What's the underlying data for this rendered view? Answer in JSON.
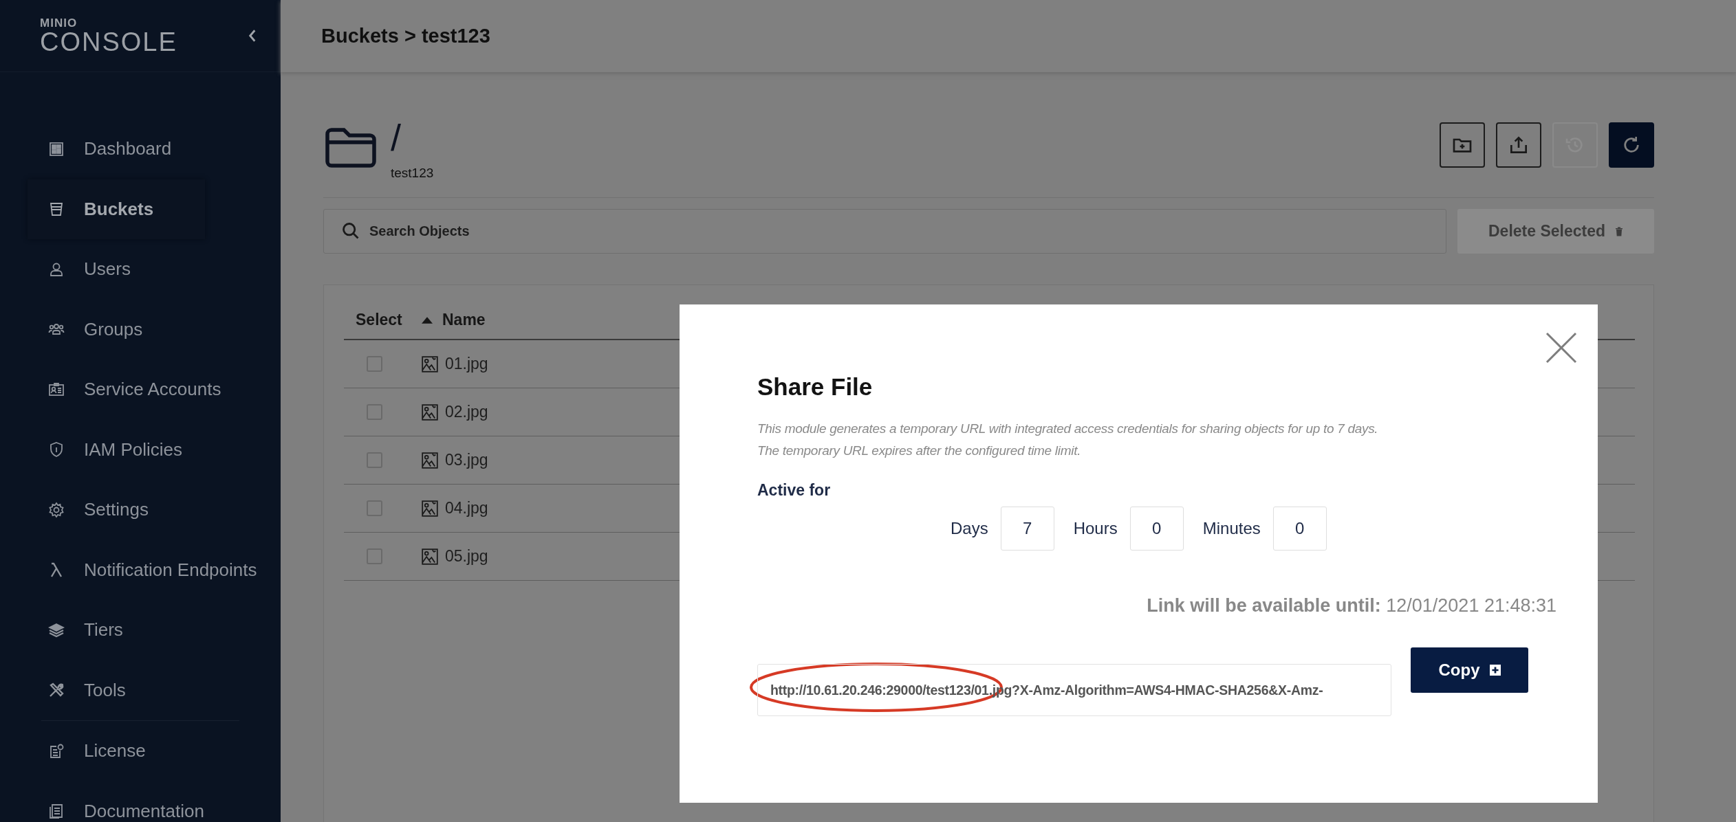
{
  "sidebar": {
    "logo_small": "MINIO",
    "logo": "CONSOLE",
    "items": [
      {
        "label": "Dashboard",
        "selected": false
      },
      {
        "label": "Buckets",
        "selected": true
      },
      {
        "label": "Users",
        "selected": false
      },
      {
        "label": "Groups",
        "selected": false
      },
      {
        "label": "Service Accounts",
        "selected": false
      },
      {
        "label": "IAM Policies",
        "selected": false
      },
      {
        "label": "Settings",
        "selected": false
      },
      {
        "label": "Notification Endpoints",
        "selected": false
      },
      {
        "label": "Tiers",
        "selected": false
      },
      {
        "label": "Tools",
        "selected": false
      }
    ],
    "secondary_items": [
      {
        "label": "License",
        "selected": false
      },
      {
        "label": "Documentation",
        "selected": false
      }
    ]
  },
  "header": {
    "breadcrumb": "Buckets > test123"
  },
  "browser": {
    "path": "/",
    "bucket": "test123",
    "toolbar": [
      {
        "kind": "outline",
        "disabled": false
      },
      {
        "kind": "outline",
        "disabled": false
      },
      {
        "kind": "outline",
        "disabled": true
      },
      {
        "kind": "filled",
        "disabled": false
      }
    ],
    "search": {
      "placeholder": "Search Objects"
    },
    "delete_button": {
      "label": "Delete Selected",
      "disabled": true
    }
  },
  "table": {
    "columns": [
      {
        "label": "Select",
        "sorted": false
      },
      {
        "label": "Name",
        "sorted": true
      }
    ],
    "rows": [
      {
        "name": "01.jpg",
        "checked": false
      },
      {
        "name": "02.jpg",
        "checked": false
      },
      {
        "name": "03.jpg",
        "checked": false
      },
      {
        "name": "04.jpg",
        "checked": false
      },
      {
        "name": "05.jpg",
        "checked": false
      }
    ]
  },
  "modal": {
    "title": "Share File",
    "description": [
      "This module generates a temporary URL with integrated access credentials for sharing objects for up to 7 days.",
      "The temporary URL expires after the configured time limit."
    ],
    "active_for": "Active for",
    "durations": [
      {
        "label": "Days",
        "value": "7"
      },
      {
        "label": "Hours",
        "value": "0"
      },
      {
        "label": "Minutes",
        "value": "0"
      }
    ],
    "expiry": {
      "label": "Link will be available until:",
      "value": "12/01/2021 21:48:31"
    },
    "url": "http://10.61.20.246:29000/test123/01.jpg?X-Amz-Algorithm=AWS4-HMAC-SHA256&X-Amz-",
    "copy_button": "Copy"
  }
}
